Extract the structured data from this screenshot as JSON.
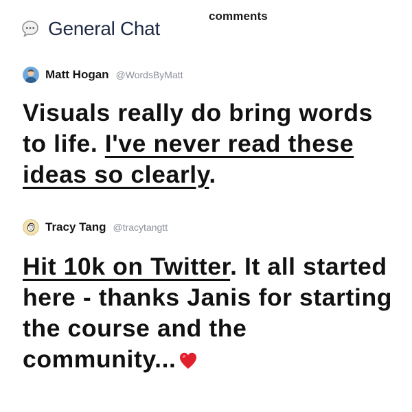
{
  "top_label": "comments",
  "channel": {
    "title": "General Chat",
    "icon": "chat-bubble-icon"
  },
  "posts": [
    {
      "author": "Matt Hogan",
      "handle": "@WordsByMatt",
      "avatar_color": "#6fa8dc",
      "message": {
        "part1": "Visuals really do bring words to life. ",
        "underlined": "I've never read these ideas so clearly",
        "part2": "."
      }
    },
    {
      "author": "Tracy Tang",
      "handle": "@tracytangtt",
      "avatar_color": "#f3e2b3",
      "message": {
        "underlined": "Hit 10k on Twitter",
        "part1": ". It all started here - thanks Janis for starting the course and the community...",
        "emoji": "heart-icon"
      }
    }
  ],
  "colors": {
    "title": "#1f2a44",
    "handle": "#8a8f98",
    "heart": "#e0202c"
  }
}
